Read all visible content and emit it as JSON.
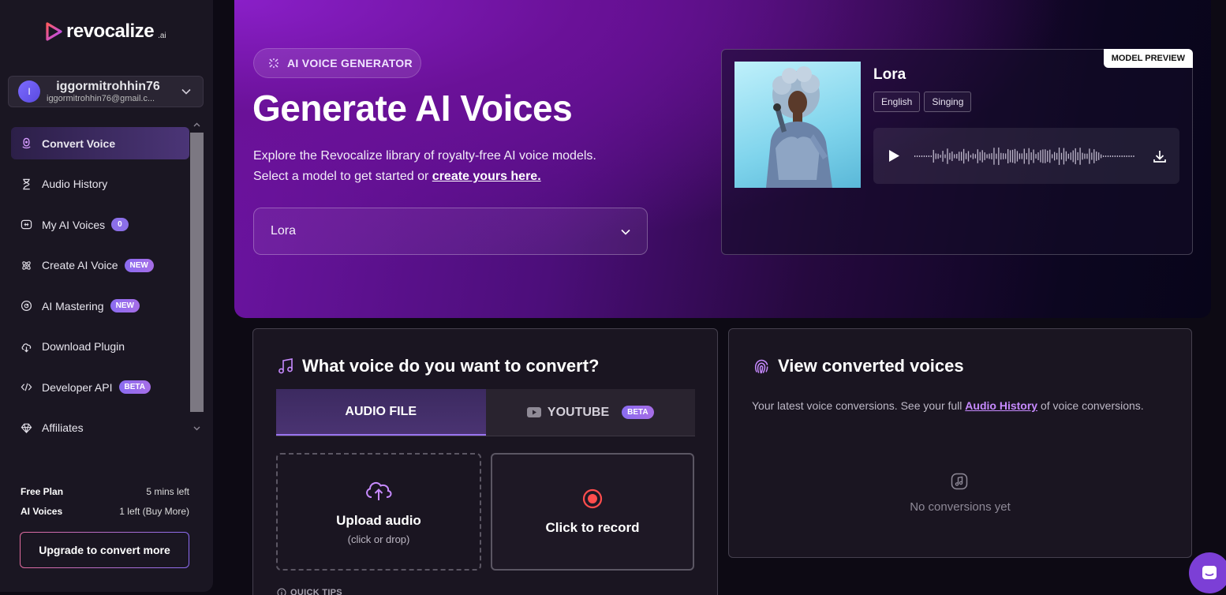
{
  "brand": {
    "name": "revocalize",
    "suffix": ".ai"
  },
  "account": {
    "initial": "I",
    "name": "iggormitrohhin76",
    "email": "iggormitrohhin76@gmail.c..."
  },
  "nav": {
    "convert_voice": "Convert Voice",
    "audio_history": "Audio History",
    "my_ai_voices": "My AI Voices",
    "my_ai_voices_count": "0",
    "create_ai_voice": "Create AI Voice",
    "create_badge": "NEW",
    "ai_mastering": "AI Mastering",
    "mastering_badge": "NEW",
    "download_plugin": "Download Plugin",
    "developer_api": "Developer API",
    "api_badge": "BETA",
    "affiliates": "Affiliates"
  },
  "plan": {
    "free_plan_label": "Free Plan",
    "free_plan_value": "5 mins left",
    "ai_voices_label": "AI Voices",
    "ai_voices_value": "1 left (Buy More)",
    "upgrade_label": "Upgrade to convert more"
  },
  "hero": {
    "pill": "AI VOICE GENERATOR",
    "title": "Generate AI Voices",
    "desc_line1": "Explore the Revocalize library of royalty-free AI voice models.",
    "desc_line2_prefix": "Select a model to get started or ",
    "desc_link": "create yours here.",
    "selected_model": "Lora"
  },
  "preview": {
    "tag": "MODEL PREVIEW",
    "name": "Lora",
    "tags": [
      "English",
      "Singing"
    ]
  },
  "convert": {
    "title": "What voice do you want to convert?",
    "tab_audio": "AUDIO FILE",
    "tab_youtube": "YOUTUBE",
    "youtube_badge": "BETA",
    "upload_label": "Upload audio",
    "upload_sub": "(click or drop)",
    "record_label": "Click to record",
    "quick_tips": "QUICK TIPS"
  },
  "converted": {
    "title": "View converted voices",
    "desc_prefix": "Your latest voice conversions. See your full ",
    "desc_link": "Audio History",
    "desc_suffix": " of voice conversions.",
    "empty": "No conversions yet"
  },
  "colors": {
    "accent": "#9a74f0",
    "record_red": "#ff4d4d",
    "sidebar_bg": "#1a1622",
    "hero_start": "#6d14a3"
  }
}
